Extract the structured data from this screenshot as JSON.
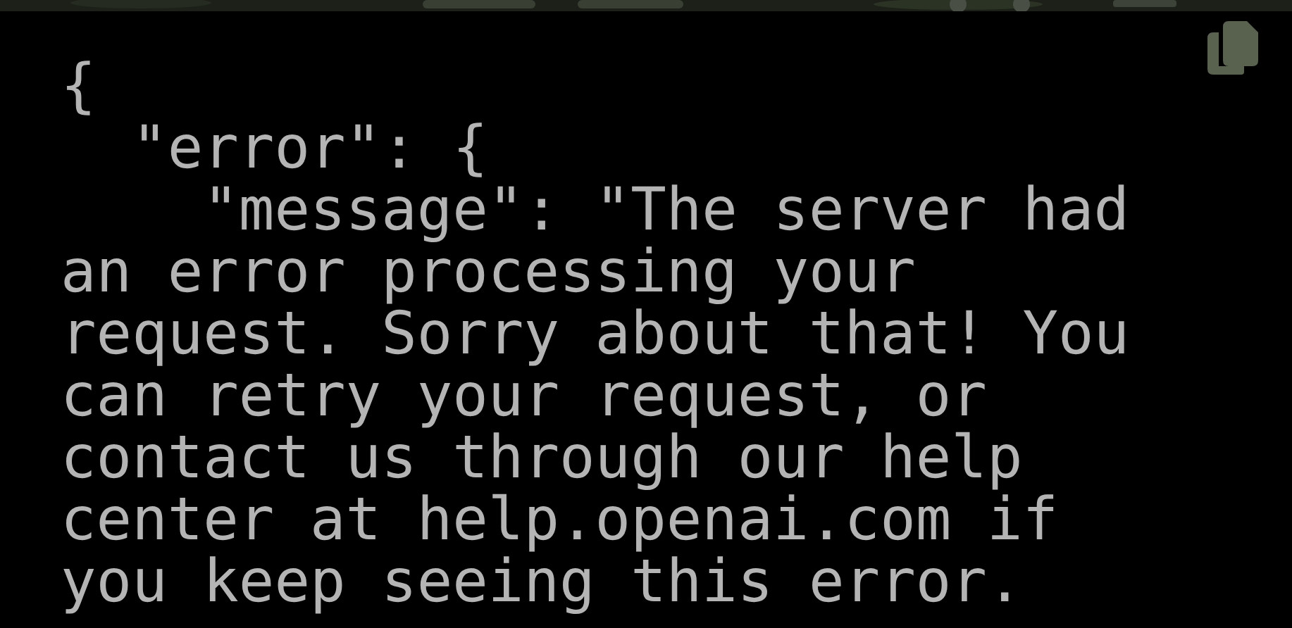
{
  "code_block": {
    "lines": [
      "{",
      "  \"error\": {",
      "    \"message\": \"The server had",
      "an error processing your",
      "request. Sorry about that! You",
      "can retry your request, or",
      "contact us through our help",
      "center at help.openai.com if",
      "you keep seeing this error."
    ]
  }
}
